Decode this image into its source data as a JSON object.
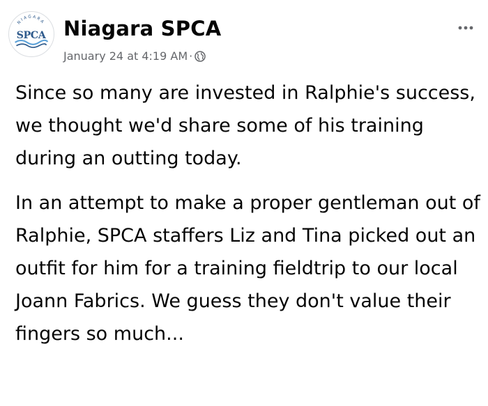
{
  "post": {
    "author": "Niagara SPCA",
    "avatar_logo_text": "SPCA",
    "avatar_logo_arc_text": "NIAGARA",
    "timestamp": "January 24 at 4:19 AM",
    "separator": "·",
    "audience_icon": "globe-icon",
    "more_icon": "more-horizontal-icon",
    "paragraphs": [
      "Since so many are invested in Ralphie's success, we thought we'd share some of his training during an outting today.",
      "In an attempt to make a proper gentleman out of Ralphie, SPCA staffers Liz and Tina picked out an outfit for him for a training fieldtrip to our local Joann Fabrics. We guess they don't value their fingers so much..."
    ]
  },
  "colors": {
    "text": "#050505",
    "secondary_text": "#65676b",
    "logo_blue": "#2e5a8c",
    "logo_wave": "#5aa0d8"
  }
}
